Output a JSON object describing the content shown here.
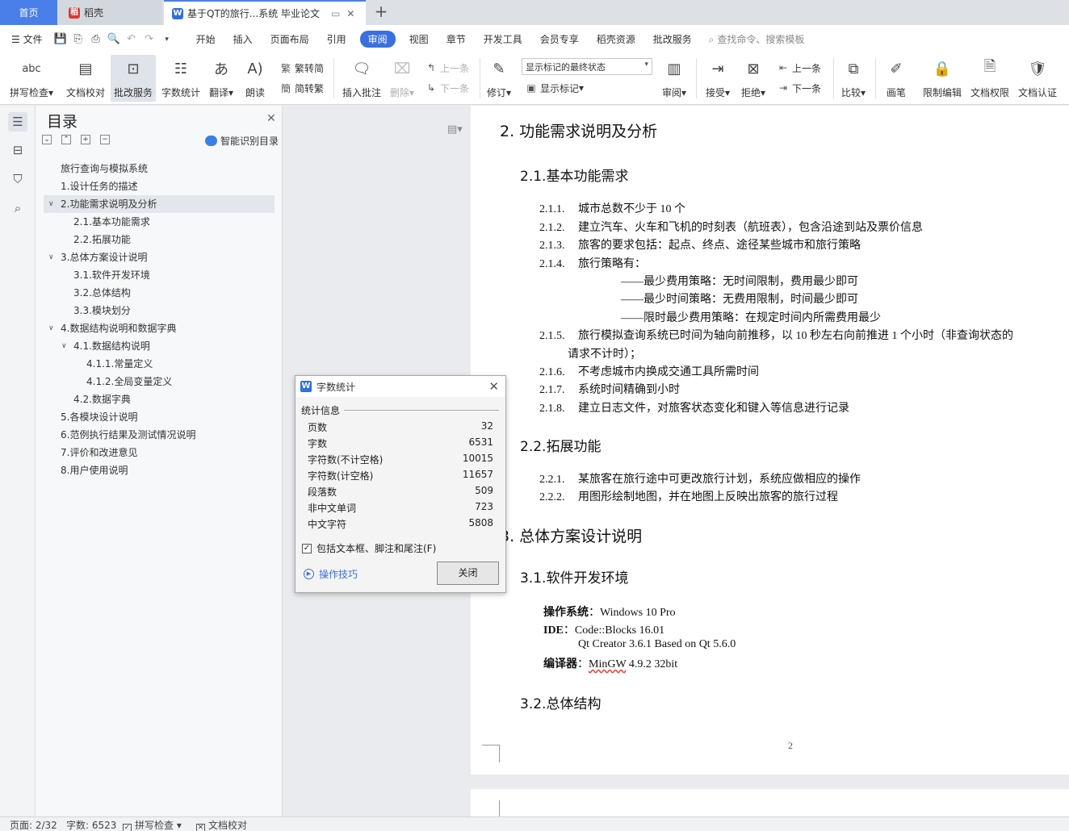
{
  "tabs": {
    "home": "首页",
    "daoke": "稻壳",
    "doc": "基于QT的旅行...系统 毕业论文"
  },
  "menus": {
    "file": "文件",
    "items": [
      "开始",
      "插入",
      "页面布局",
      "引用",
      "审阅",
      "视图",
      "章节",
      "开发工具",
      "会员专享",
      "稻壳资源",
      "批改服务"
    ],
    "search": "查找命令、搜索模板"
  },
  "ribbon": {
    "spell": "拼写检查",
    "proof": "文档校对",
    "correct": "批改服务",
    "wordcount": "字数统计",
    "translate": "翻译",
    "read": "朗读",
    "to_trad": "繁转简",
    "to_simp": "简转繁",
    "insert_comment": "插入批注",
    "delete": "删除",
    "prev": "上一条",
    "next": "下一条",
    "revise": "修订",
    "mark_state": "显示标记的最终状态",
    "show_marks": "显示标记",
    "review": "审阅",
    "accept": "接受",
    "reject": "拒绝",
    "prev2": "上一条",
    "next2": "下一条",
    "compare": "比较",
    "pen": "画笔",
    "restrict": "限制编辑",
    "perm": "文档权限",
    "cert": "文档认证"
  },
  "toc": {
    "title": "目录",
    "ai_label": "智能识别目录",
    "items": [
      "旅行查询与模拟系统",
      "1.设计任务的描述",
      "2.功能需求说明及分析",
      "2.1.基本功能需求",
      "2.2.拓展功能",
      "3.总体方案设计说明",
      "3.1.软件开发环境",
      "3.2.总体结构",
      "3.3.模块划分",
      "4.数据结构说明和数据字典",
      "4.1.数据结构说明",
      "4.1.1.常量定义",
      "4.1.2.全局变量定义",
      "4.2.数据字典",
      "5.各模块设计说明",
      "6.范例执行结果及测试情况说明",
      "7.评价和改进意见",
      "8.用户使用说明"
    ]
  },
  "doc": {
    "h2": "2.  功能需求说明及分析",
    "h21": "2.1.基本功能需求",
    "l211n": "2.1.1.",
    "l211": "城市总数不少于 10 个",
    "l212n": "2.1.2.",
    "l212": "建立汽车、火车和飞机的时刻表（航班表），包含沿途到站及票价信息",
    "l213n": "2.1.3.",
    "l213": "旅客的要求包括：起点、终点、途径某些城市和旅行策略",
    "l214n": "2.1.4.",
    "l214": "旅行策略有：",
    "s1": "——最少费用策略：无时间限制，费用最少即可",
    "s2": "——最少时间策略：无费用限制，时间最少即可",
    "s3": "——限时最少费用策略：在规定时间内所需费用最少",
    "l215n": "2.1.5.",
    "l215": "旅行模拟查询系统已时间为轴向前推移，以 10 秒左右向前推进 1 个小时（非查询状态的",
    "l215b": "请求不计时）；",
    "l216n": "2.1.6.",
    "l216": "不考虑城市内换成交通工具所需时间",
    "l217n": "2.1.7.",
    "l217": "系统时间精确到小时",
    "l218n": "2.1.8.",
    "l218": "建立日志文件，对旅客状态变化和键入等信息进行记录",
    "h22": "2.2.拓展功能",
    "l221n": "2.2.1.",
    "l221": "某旅客在旅行途中可更改旅行计划，系统应做相应的操作",
    "l222n": "2.2.2.",
    "l222": "用图形绘制地图，并在地图上反映出旅客的旅行过程",
    "h3": "3.  总体方案设计说明",
    "h31": "3.1.软件开发环境",
    "os_l": "操作系统",
    "os_v": "：Windows 10 Pro",
    "ide_l": "IDE",
    "ide_v": "：Code::Blocks 16.01",
    "ide_v2": "Qt Creator 3.6.1 Based on Qt 5.6.0",
    "cc_l": "编译器",
    "cc_c": "：",
    "cc_v": "MinGW",
    "cc_v2": " 4.9.2 32bit",
    "h32": "3.2.总体结构",
    "pagenum": "2"
  },
  "dialog": {
    "title": "字数统计",
    "section": "统计信息",
    "rows": [
      {
        "k": "页数",
        "v": "32"
      },
      {
        "k": "字数",
        "v": "6531"
      },
      {
        "k": "字符数(不计空格)",
        "v": "10015"
      },
      {
        "k": "字符数(计空格)",
        "v": "11657"
      },
      {
        "k": "段落数",
        "v": "509"
      },
      {
        "k": "非中文单词",
        "v": "723"
      },
      {
        "k": "中文字符",
        "v": "5808"
      }
    ],
    "include": "包括文本框、脚注和尾注(F)",
    "tips": "操作技巧",
    "close": "关闭"
  },
  "status": {
    "page": "页面: 2/32",
    "words": "字数: 6523",
    "spell": "拼写检查",
    "proof": "文档校对"
  },
  "colors": {
    "accent": "#3a6fe0",
    "tabHome": "#4a7ee8"
  }
}
